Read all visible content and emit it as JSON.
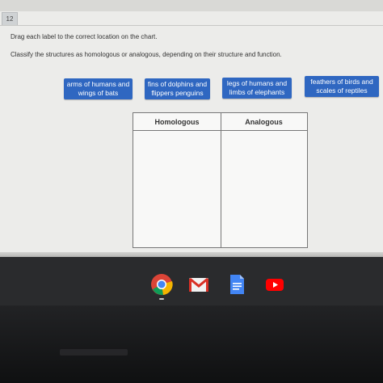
{
  "question": {
    "number": "12",
    "instruction": "Drag each label to the correct location on the chart.",
    "prompt": "Classify the structures as homologous or analogous, depending on their structure and function."
  },
  "labels": [
    {
      "text": "arms of humans and wings of bats"
    },
    {
      "text": "fins of dolphins and flippers penguins"
    },
    {
      "text": "legs of humans and limbs of elephants"
    },
    {
      "text": "feathers of birds and scales of reptiles"
    }
  ],
  "chart": {
    "headers": [
      "Homologous",
      "Analogous"
    ]
  },
  "taskbar": {
    "apps": [
      {
        "name": "chrome-icon"
      },
      {
        "name": "gmail-icon"
      },
      {
        "name": "docs-icon"
      },
      {
        "name": "youtube-icon"
      }
    ]
  },
  "colors": {
    "label_bg": "#2f67c1",
    "label_text": "#ffffff",
    "page_bg": "#ececea"
  }
}
